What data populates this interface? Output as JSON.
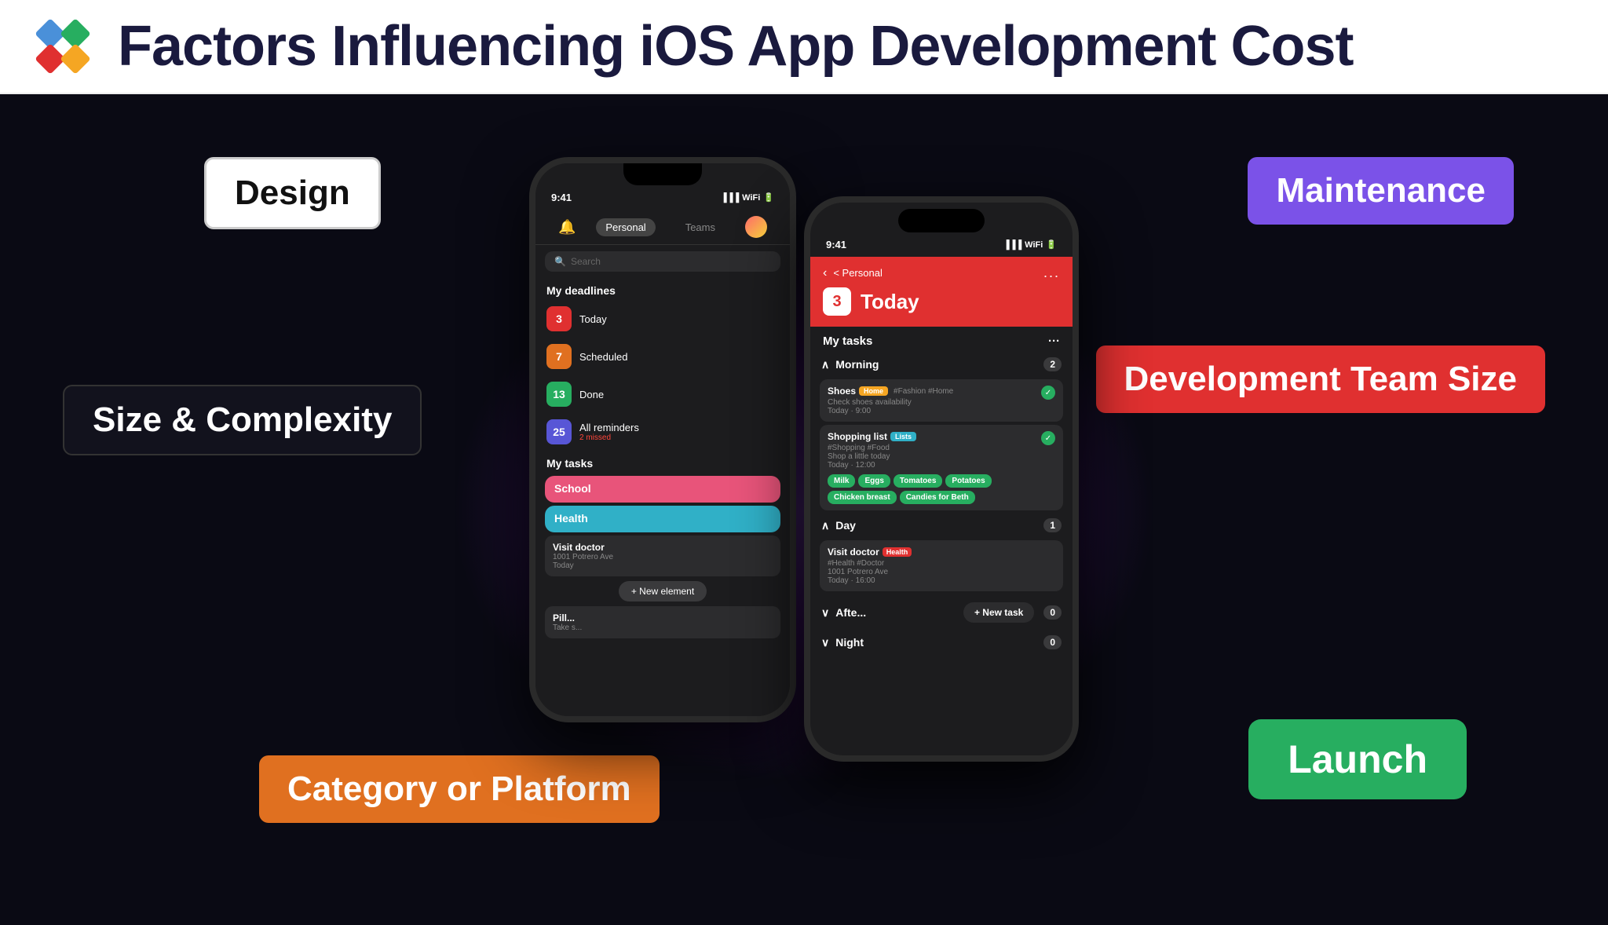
{
  "header": {
    "title": "Factors Influencing iOS App Development Cost",
    "logo_alt": "company-logo"
  },
  "badges": {
    "design": "Design",
    "size": "Size & Complexity",
    "maintenance": "Maintenance",
    "dev_team": "Development Team Size",
    "launch": "Launch",
    "category": "Category or Platform"
  },
  "phone_back": {
    "status_time": "9:41",
    "nav_tabs": [
      "Personal",
      "Teams"
    ],
    "search_placeholder": "Search",
    "deadlines_label": "My deadlines",
    "reminder_today": {
      "count": "3",
      "label": "Today",
      "color": "#e03030"
    },
    "reminder_scheduled": {
      "count": "7",
      "label": "Scheduled",
      "color": "#e07020"
    },
    "reminder_done": {
      "count": "13",
      "label": "Done",
      "color": "#27ae60"
    },
    "reminder_all": {
      "count": "25",
      "label": "All reminders",
      "sub": "2 missed",
      "color": "#5856d6"
    },
    "tasks_label": "My tasks",
    "task_school": "School",
    "task_health": "Health",
    "task_visit_doctor": "Visit doctor",
    "task_visit_doctor_addr": "1001 Potrero Ave",
    "task_visit_doctor_time": "Today",
    "task_pill": "Pill...",
    "task_pill_sub": "Take s...",
    "new_element": "+ New element"
  },
  "phone_front": {
    "status_time": "9:41",
    "nav_back": "< Personal",
    "nav_dots": "...",
    "today_num": "3",
    "today_label": "Today",
    "tasks_label": "My tasks",
    "morning_label": "Morning",
    "morning_count": "2",
    "shoes_title": "Shoes",
    "shoes_tag": "Home",
    "shoes_hashtags": "#Fashion #Home",
    "shoes_sub": "Check shoes availability",
    "shoes_time": "Today · 9:00",
    "shopping_title": "Shopping list",
    "shopping_tag": "Lists",
    "shopping_hashtags": "#Shopping #Food",
    "shopping_sub": "Shop a little today",
    "shopping_time": "Today · 12:00",
    "grocery_items": [
      "Milk",
      "Eggs",
      "Tomatoes",
      "Potatoes",
      "Chicken breast",
      "Candies for Beth"
    ],
    "day_label": "Day",
    "day_count": "1",
    "visit_doctor_title": "Visit doctor",
    "visit_doctor_tag": "Health",
    "visit_doctor_hashtags": "#Health #Doctor",
    "visit_doctor_addr": "1001 Potrero Ave",
    "visit_doctor_time": "Today · 16:00",
    "afternoon_label": "Afte...",
    "afternoon_count": "0",
    "new_task": "+ New task",
    "night_label": "Night",
    "night_count": "0"
  }
}
